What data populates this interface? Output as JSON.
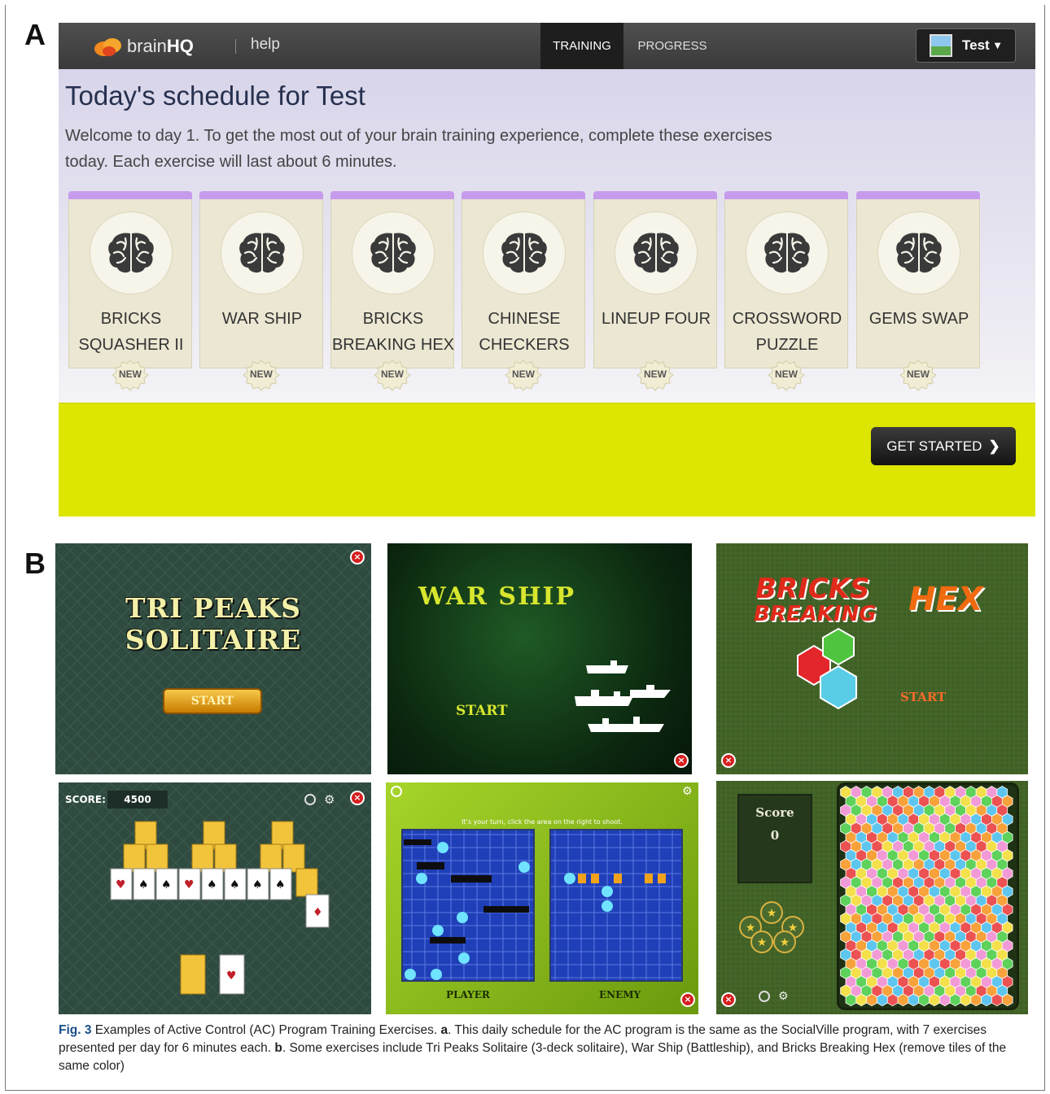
{
  "panel_labels": {
    "a": "A",
    "b": "B"
  },
  "brainhq": {
    "logo_text_light": "brain",
    "logo_text_bold": "HQ",
    "help_link": "help",
    "tabs": [
      "TRAINING",
      "PROGRESS"
    ],
    "active_tab": "TRAINING",
    "user_name": "Test",
    "page_title": "Today's schedule for Test",
    "intro": "Welcome to day 1. To get the most out of your brain training experience, complete these exercises today. Each exercise will last about 6 minutes.",
    "exercises": [
      {
        "line1": "BRICKS",
        "line2": "SQUASHER II",
        "badge": "NEW"
      },
      {
        "line1": "WAR SHIP",
        "line2": "",
        "badge": "NEW"
      },
      {
        "line1": "BRICKS",
        "line2": "BREAKING HEX",
        "badge": "NEW"
      },
      {
        "line1": "CHINESE",
        "line2": "CHECKERS",
        "badge": "NEW"
      },
      {
        "line1": "LINEUP FOUR",
        "line2": "",
        "badge": "NEW"
      },
      {
        "line1": "CROSSWORD",
        "line2": "PUZZLE",
        "badge": "NEW"
      },
      {
        "line1": "GEMS SWAP",
        "line2": "",
        "badge": "NEW"
      }
    ],
    "get_started": "GET STARTED",
    "colors": {
      "nav": "#3f3f3f",
      "card_top": "#c79bec",
      "card": "#ebe7d2",
      "yellow_band": "#dde600"
    }
  },
  "games": {
    "tripeaks": {
      "title": "TRI PEAKS SOLITAIRE",
      "start": "START",
      "score_label": "SCORE:",
      "score_value": "4500"
    },
    "warship": {
      "title": "WAR SHIP",
      "start": "START",
      "instruction": "It's your turn, click the area on the right to shoot.",
      "player_label": "PLAYER",
      "enemy_label": "ENEMY"
    },
    "bricks": {
      "title_line1": "BRICKS",
      "title_line2": "BREAKING",
      "title_hex": "HEX",
      "start": "START",
      "score_label": "Score",
      "score_value": "0"
    }
  },
  "caption": {
    "fig_label": "Fig. 3",
    "text1": " Examples of Active Control (AC) Program Training Exercises. ",
    "a": "a",
    "text2": ". This daily schedule for the AC program is the same as the SocialVille program, with 7 exercises presented per day for 6 minutes each. ",
    "b": "b",
    "text3": ". Some exercises include Tri Peaks Solitaire (3-deck solitaire), War Ship (Battleship), and Bricks Breaking Hex (remove tiles of the same color)"
  }
}
